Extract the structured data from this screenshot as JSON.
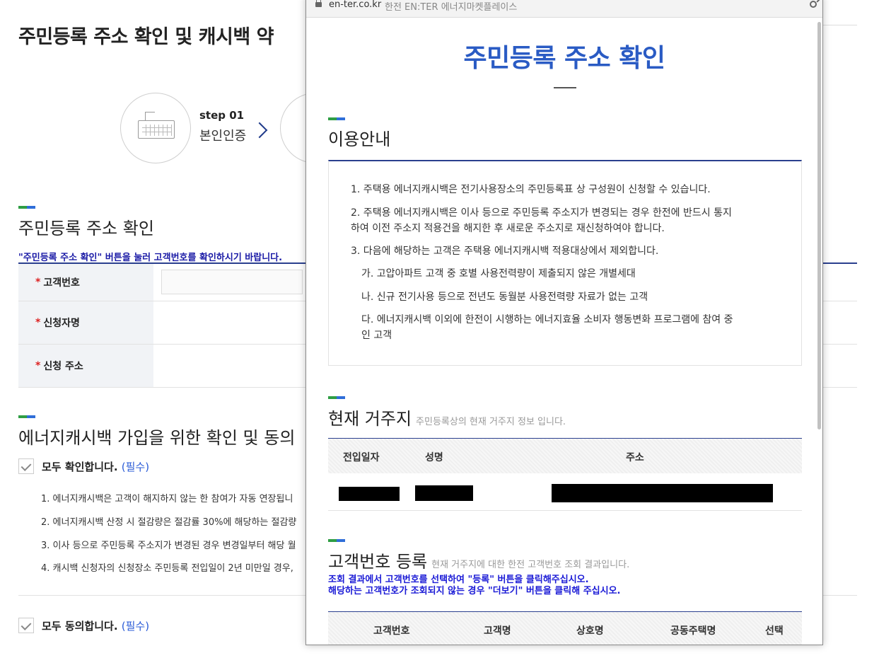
{
  "background": {
    "page_title": "주민등록 주소 확인 및 캐시백 약",
    "steps": [
      {
        "number": "step 01",
        "name": "본인인증"
      }
    ],
    "address_section": {
      "title": "주민등록 주소 확인",
      "hint": "\"주민등록 주소 확인\" 버튼을 눌러 고객번호를 확인하시기 바랍니다.",
      "fields": [
        {
          "label": "고객번호",
          "value": ""
        },
        {
          "label": "신청자명",
          "value": ""
        },
        {
          "label": "신청 주소",
          "value": ""
        }
      ]
    },
    "consent_section": {
      "title": "에너지캐시백 가입을 위한 확인 및 동의",
      "confirm_all": {
        "label": "모두 확인합니다.",
        "required": "(필수)"
      },
      "items": [
        "1. 에너지캐시백은 고객이 해지하지 않는 한 참여가 자동 연장됩니",
        "2. 에너지캐시백 산정 시 절감량은 절감률 30%에 해당하는 절감량",
        "3. 이사 등으로 주민등록 주소지가 변경된 경우 변경일부터 해당 월",
        "4. 캐시백 신청자의 신청장소 주민등록 전입일이 2년 미만일 경우,"
      ],
      "agree_all": {
        "label": "모두 동의합니다.",
        "required": "(필수)"
      }
    }
  },
  "popup": {
    "url_host": "en-ter.co.kr",
    "window_title": "한전 EN:TER 에너지마켓플레이스",
    "title": "주민등록 주소 확인",
    "guide": {
      "title": "이용안내",
      "lines": [
        "1. 주택용 에너지캐시백은 전기사용장소의 주민등록표 상 구성원이 신청할 수 있습니다.",
        "2. 주택용 에너지캐시백은 이사 등으로 주민등록 주소지가 변경되는 경우 한전에 반드시 통지",
        "하여 이전 주소지 적용건을 해지한 후 새로운 주소지로 재신청하여야 합니다.",
        "3. 다음에 해당하는 고객은 주택용 에너지캐시백 적용대상에서 제외합니다.",
        "가. 고압아파트 고객 중 호별 사용전력량이 제출되지 않은 개별세대",
        "나. 신규 전기사용 등으로 전년도 동월분 사용전력량 자료가 없는 고객",
        "다. 에너지캐시백 이외에 한전이 시행하는 에너지효율 소비자 행동변화 프로그램에 참여 중",
        "인 고객"
      ]
    },
    "residence": {
      "title": "현재 거주지",
      "subtitle": "주민등록상의 현재 거주지 정보 입니다.",
      "columns": [
        "전입일자",
        "성명",
        "주소"
      ]
    },
    "customer_register": {
      "title": "고객번호 등록",
      "subtitle": "현재 거주지에 대한 한전 고객번호 조회 결과입니다.",
      "hint_line1": "조회 결과에서 고객번호를 선택하여 \"등록\" 버튼을 클릭해주십시오.",
      "hint_line2": "해당하는 고객번호가 조회되지 않는 경우 \"더보기\" 버튼을 클릭해 주십시오.",
      "columns": [
        "고객번호",
        "고객명",
        "상호명",
        "공동주택명",
        "선택"
      ]
    }
  }
}
